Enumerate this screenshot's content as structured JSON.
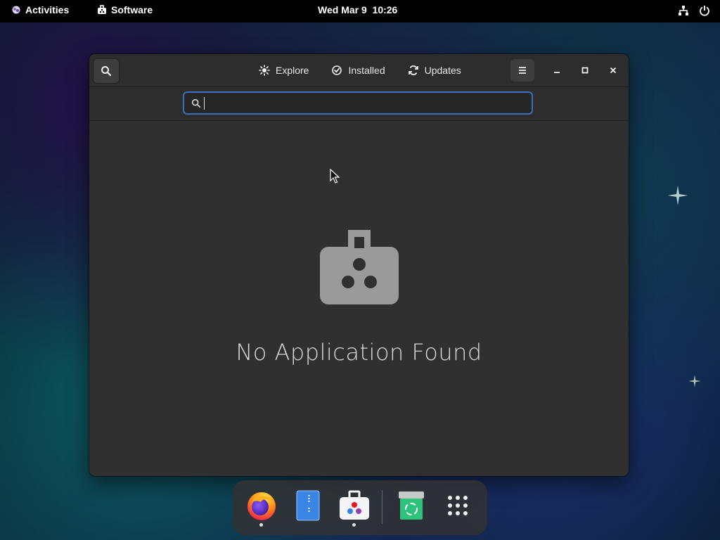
{
  "topbar": {
    "activities_label": "Activities",
    "app_label": "Software",
    "clock": "Wed Mar 9  10:26",
    "tray_icons": [
      "network-icon",
      "power-icon"
    ]
  },
  "window": {
    "tabs": [
      {
        "label": "Explore",
        "icon": "explore-icon"
      },
      {
        "label": "Installed",
        "icon": "check-circle-icon"
      },
      {
        "label": "Updates",
        "icon": "refresh-icon"
      }
    ],
    "search": {
      "value": "",
      "placeholder": ""
    },
    "empty_state": {
      "text": "No Application Found",
      "icon": "bag-icon"
    }
  },
  "dock": {
    "items": [
      "firefox-icon",
      "files-icon",
      "software-icon",
      "trash-icon",
      "app-grid-icon"
    ]
  },
  "colors": {
    "accent": "#3d6fb6",
    "window_bg": "#303030",
    "headerbar_bg": "#2d2d2d"
  }
}
